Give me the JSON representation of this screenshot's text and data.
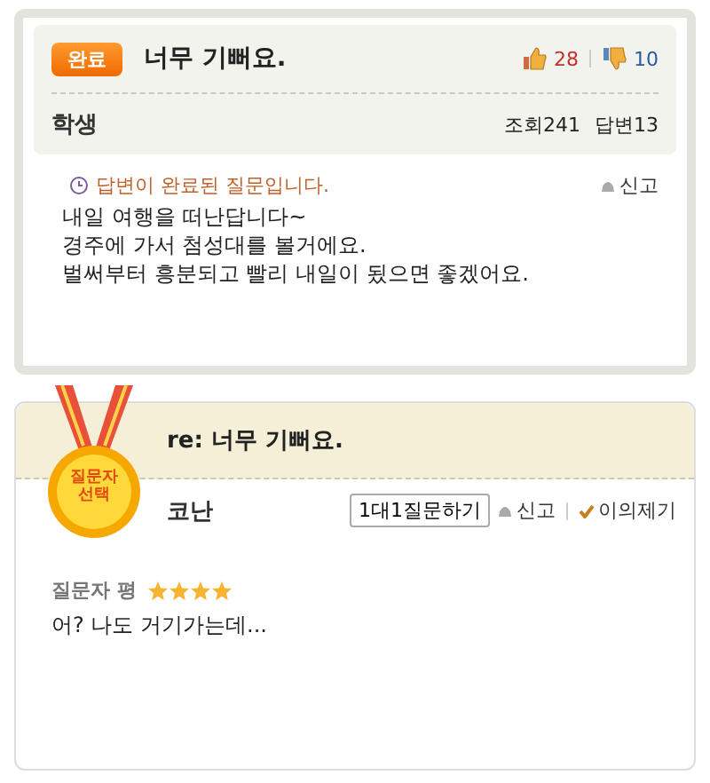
{
  "question": {
    "badge": "완료",
    "title": "너무 기뻐요.",
    "likes": "28",
    "dislikes": "10",
    "author": "학생",
    "views": "조회241",
    "answers": "답변13",
    "status": "답변이 완료된 질문입니다.",
    "report": "신고",
    "body": [
      "내일 여행을 떠난답니다~",
      "경주에 가서 첨성대를 볼거에요.",
      "벌써부터 흥분되고 빨리 내일이 됬으면 좋겠어요."
    ]
  },
  "answer": {
    "medal": "질문자\n선택",
    "title": "re: 너무 기뻐요.",
    "author": "코난",
    "ask_button": "1대1질문하기",
    "report": "신고",
    "objection": "이의제기",
    "rating_label": "질문자 평",
    "stars": 4,
    "body": "어? 나도 거기가는데..."
  }
}
